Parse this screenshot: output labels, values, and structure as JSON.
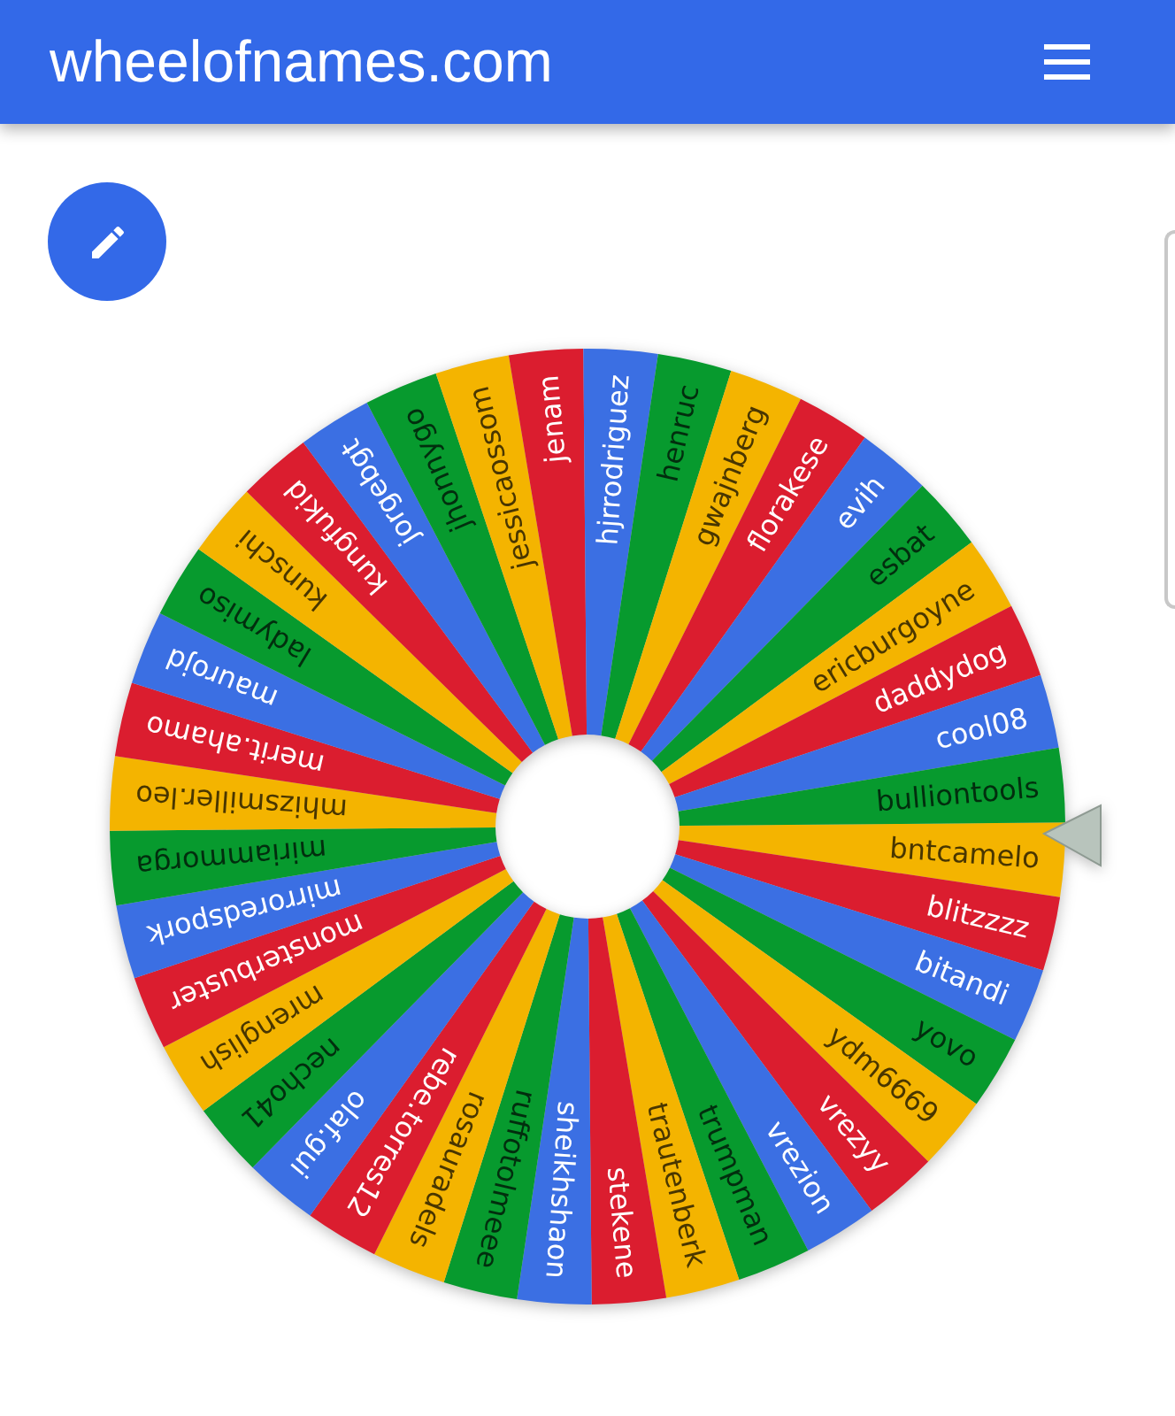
{
  "header": {
    "title": "wheelofnames.com"
  },
  "wheel": {
    "slices": [
      {
        "name": "bntcamelo",
        "color": "#f4b400"
      },
      {
        "name": "blitzzzz",
        "color": "#db1d2f"
      },
      {
        "name": "bitandi",
        "color": "#3b6fe3"
      },
      {
        "name": "yovo",
        "color": "#079a2e"
      },
      {
        "name": "ydm6669",
        "color": "#f4b400"
      },
      {
        "name": "vrezyy",
        "color": "#db1d2f"
      },
      {
        "name": "vrezion",
        "color": "#3b6fe3"
      },
      {
        "name": "trumpman",
        "color": "#079a2e"
      },
      {
        "name": "trautenberk",
        "color": "#f4b400"
      },
      {
        "name": "stekene",
        "color": "#db1d2f"
      },
      {
        "name": "sheikhshaon",
        "color": "#3b6fe3"
      },
      {
        "name": "ruffotolmeee",
        "color": "#079a2e"
      },
      {
        "name": "rosauradels",
        "color": "#f4b400"
      },
      {
        "name": "rebe.torres12",
        "color": "#db1d2f"
      },
      {
        "name": "olaf.gui",
        "color": "#3b6fe3"
      },
      {
        "name": "necho41",
        "color": "#079a2e"
      },
      {
        "name": "mrenglish",
        "color": "#f4b400"
      },
      {
        "name": "monsterbuster",
        "color": "#db1d2f"
      },
      {
        "name": "mirroredspork",
        "color": "#3b6fe3"
      },
      {
        "name": "miriammorga",
        "color": "#079a2e"
      },
      {
        "name": "mhizsmiller.leo",
        "color": "#f4b400"
      },
      {
        "name": "merit.ahamo",
        "color": "#db1d2f"
      },
      {
        "name": "maurojd",
        "color": "#3b6fe3"
      },
      {
        "name": "ladymiso",
        "color": "#079a2e"
      },
      {
        "name": "kunschi",
        "color": "#f4b400"
      },
      {
        "name": "kungfukid",
        "color": "#db1d2f"
      },
      {
        "name": "jorgebgt",
        "color": "#3b6fe3"
      },
      {
        "name": "jhonnygo",
        "color": "#079a2e"
      },
      {
        "name": "jessicaossom",
        "color": "#f4b400"
      },
      {
        "name": "jenam",
        "color": "#db1d2f"
      },
      {
        "name": "hjrrodriguez",
        "color": "#3b6fe3"
      },
      {
        "name": "henruc",
        "color": "#079a2e"
      },
      {
        "name": "gwajnberg",
        "color": "#f4b400"
      },
      {
        "name": "florakese",
        "color": "#db1d2f"
      },
      {
        "name": "evih",
        "color": "#3b6fe3"
      },
      {
        "name": "esbat",
        "color": "#079a2e"
      },
      {
        "name": "ericburgoyne",
        "color": "#f4b400"
      },
      {
        "name": "daddydog",
        "color": "#db1d2f"
      },
      {
        "name": "cool08",
        "color": "#3b6fe3"
      },
      {
        "name": "bulliontools",
        "color": "#079a2e"
      }
    ]
  }
}
